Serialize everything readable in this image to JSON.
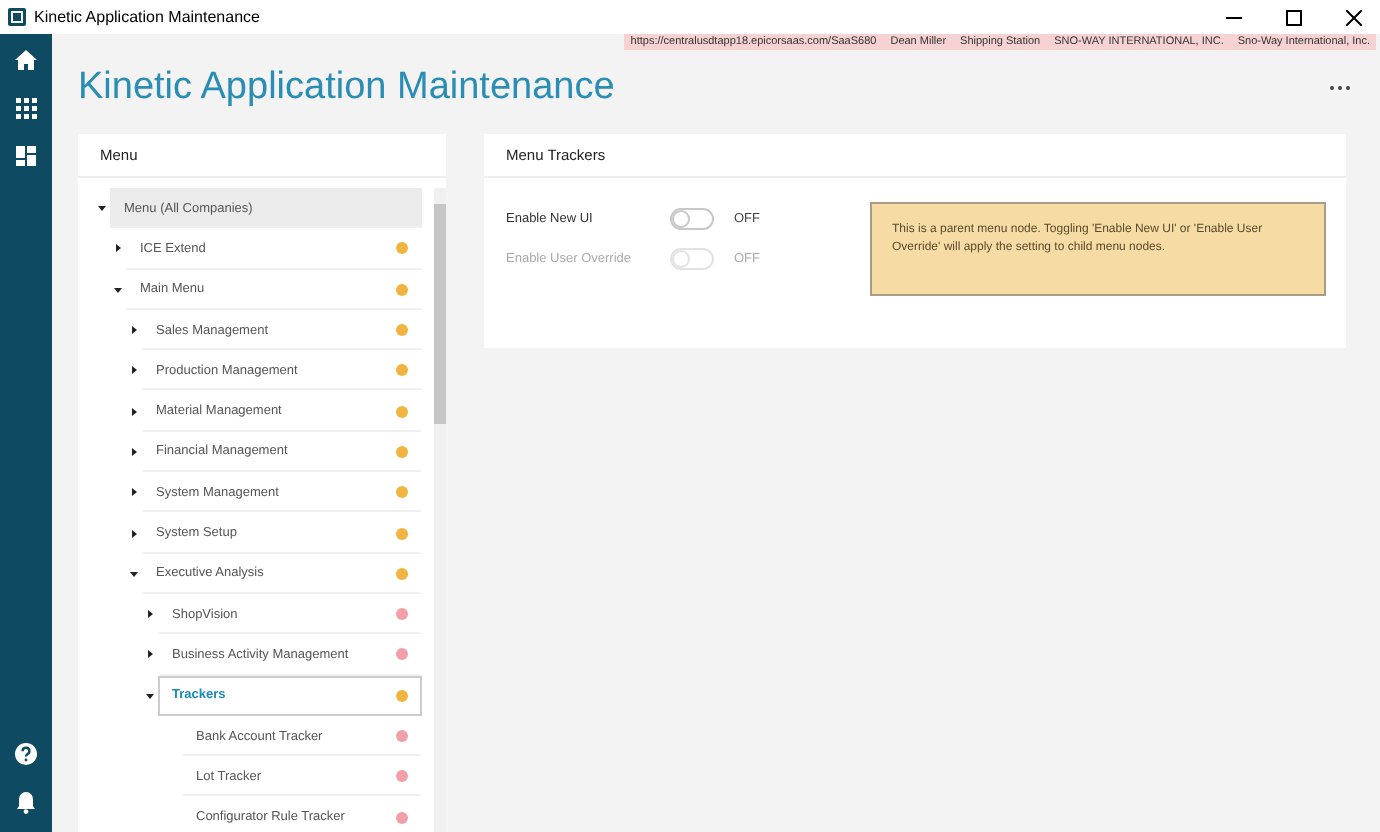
{
  "window": {
    "title": "Kinetic Application Maintenance"
  },
  "context_bar": [
    "https://centralusdtapp18.epicorsaas.com/SaaS680",
    "Dean Miller",
    "Shipping Station",
    "SNO-WAY INTERNATIONAL, INC.",
    "Sno-Way International, Inc."
  ],
  "page_title": "Kinetic Application Maintenance",
  "menu_panel": {
    "title": "Menu",
    "tree": [
      {
        "label": "Menu (All Companies)",
        "expanded": true,
        "selected": false,
        "highlighted": true,
        "children": [
          {
            "label": "ICE Extend",
            "expanded": false,
            "selected": false,
            "highlighted": false,
            "color": "#f0b540"
          },
          {
            "label": "Main Menu",
            "expanded": true,
            "selected": false,
            "highlighted": false,
            "color": "#f0b540",
            "children": [
              {
                "label": "Sales Management",
                "expanded": false,
                "selected": false,
                "highlighted": false,
                "color": "#f0b540"
              },
              {
                "label": "Production Management",
                "expanded": false,
                "selected": false,
                "highlighted": false,
                "color": "#f0b540"
              },
              {
                "label": "Material Management",
                "expanded": false,
                "selected": false,
                "highlighted": false,
                "color": "#f0b540"
              },
              {
                "label": "Financial Management",
                "expanded": false,
                "selected": false,
                "highlighted": false,
                "color": "#f0b540"
              },
              {
                "label": "System Management",
                "expanded": false,
                "selected": false,
                "highlighted": false,
                "color": "#f0b540"
              },
              {
                "label": "System Setup",
                "expanded": false,
                "selected": false,
                "highlighted": false,
                "color": "#f0b540"
              },
              {
                "label": "Executive Analysis",
                "expanded": true,
                "selected": false,
                "highlighted": false,
                "color": "#f0b540",
                "children": [
                  {
                    "label": "ShopVision",
                    "expanded": false,
                    "selected": false,
                    "highlighted": false,
                    "color": "#f2a0a8"
                  },
                  {
                    "label": "Business Activity Management",
                    "expanded": false,
                    "selected": false,
                    "highlighted": false,
                    "color": "#f2a0a8"
                  },
                  {
                    "label": "Trackers",
                    "expanded": true,
                    "selected": true,
                    "highlighted": false,
                    "color": "#f0b540",
                    "children": [
                      {
                        "label": "Bank Account Tracker",
                        "selected": false,
                        "highlighted": false,
                        "color": "#f2a0a8"
                      },
                      {
                        "label": "Lot Tracker",
                        "selected": false,
                        "highlighted": false,
                        "color": "#f2a0a8"
                      },
                      {
                        "label": "Configurator Rule Tracker",
                        "selected": false,
                        "highlighted": false,
                        "color": "#f2a0a8"
                      }
                    ]
                  }
                ]
              }
            ]
          }
        ]
      }
    ]
  },
  "detail_panel": {
    "title": "Menu Trackers",
    "toggles": [
      {
        "label": "Enable New UI",
        "on": false,
        "disabled": false,
        "state_text": "OFF"
      },
      {
        "label": "Enable User Override",
        "on": false,
        "disabled": true,
        "state_text": "OFF"
      }
    ],
    "notice": "This is a parent menu node. Toggling 'Enable New UI' or 'Enable User Override' will apply the setting to child menu nodes."
  }
}
